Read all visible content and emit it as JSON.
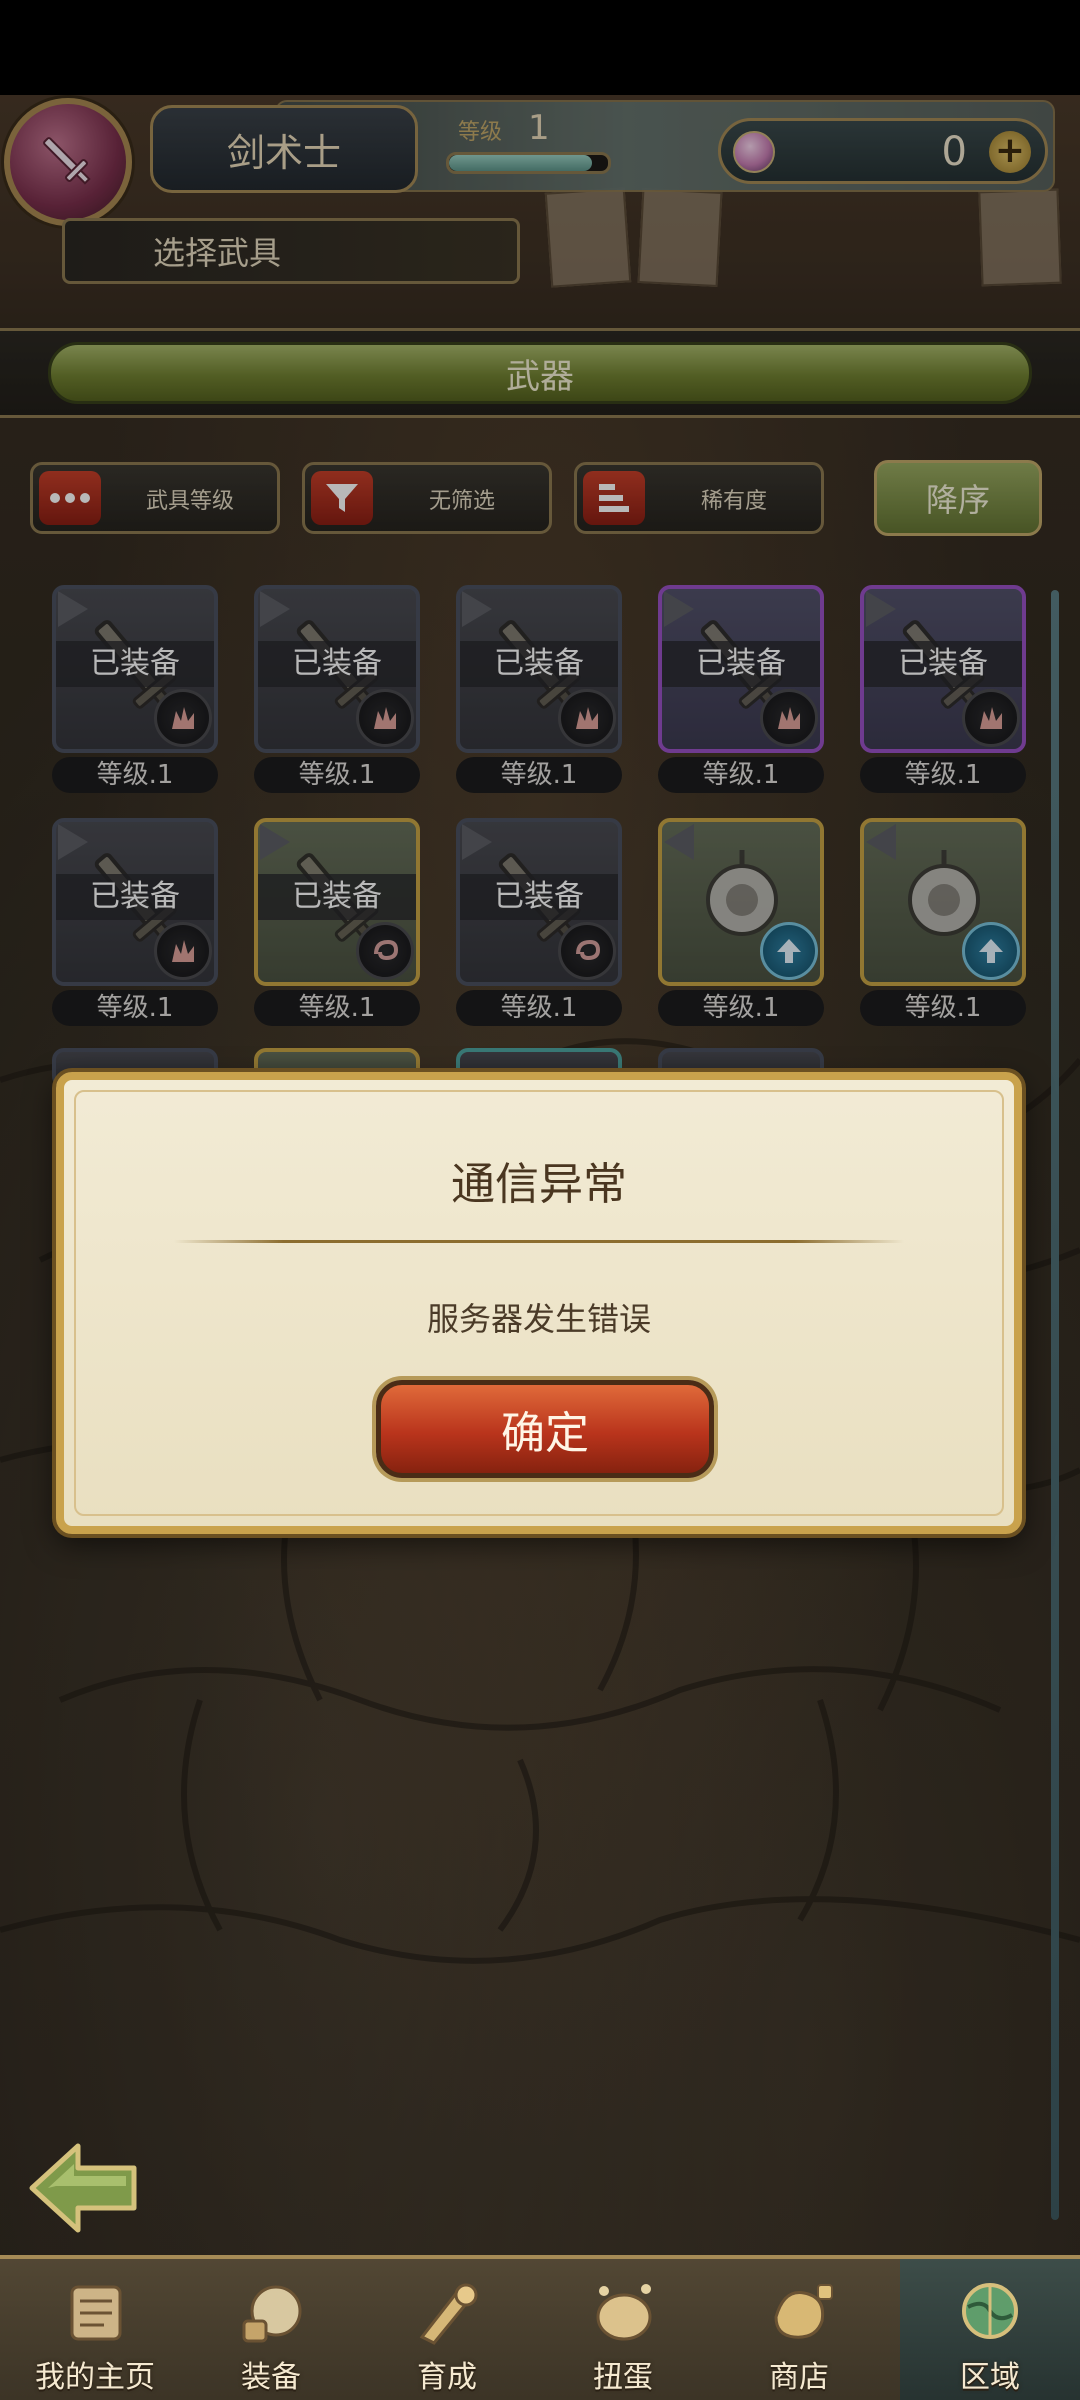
{
  "header": {
    "role_name": "剑术士",
    "level_label": "等级",
    "level_value": "1",
    "level_progress": 0.9,
    "currency_value": "0",
    "subtitle": "选择武具",
    "active_tab": "武器"
  },
  "filters": [
    {
      "label": "武具等级",
      "icon": "dots-icon"
    },
    {
      "label": "无筛选",
      "icon": "funnel-icon"
    },
    {
      "label": "稀有度",
      "icon": "bars-icon"
    }
  ],
  "sort_label": "降序",
  "weapons": [
    {
      "status": "已装备",
      "level": "等级.1",
      "frame": "normal",
      "element": "fire"
    },
    {
      "status": "已装备",
      "level": "等级.1",
      "frame": "normal",
      "element": "fire"
    },
    {
      "status": "已装备",
      "level": "等级.1",
      "frame": "normal",
      "element": "fire"
    },
    {
      "status": "已装备",
      "level": "等级.1",
      "frame": "rare",
      "element": "fire"
    },
    {
      "status": "已装备",
      "level": "等级.1",
      "frame": "rare",
      "element": "fire"
    },
    {
      "status": "已装备",
      "level": "等级.1",
      "frame": "normal",
      "element": "fire"
    },
    {
      "status": "已装备",
      "level": "等级.1",
      "frame": "gold",
      "element": "wind"
    },
    {
      "status": "已装备",
      "level": "等级.1",
      "frame": "normal",
      "element": "wind"
    },
    {
      "status": "",
      "level": "等级.1",
      "frame": "gold",
      "element": "upgrade"
    },
    {
      "status": "",
      "level": "等级.1",
      "frame": "gold",
      "element": "upgrade"
    }
  ],
  "dialog": {
    "title": "通信异常",
    "message": "服务器发生错误",
    "confirm": "确定"
  },
  "nav": [
    {
      "label": "我的主页",
      "icon": "scroll-icon"
    },
    {
      "label": "装备",
      "icon": "equipment-icon"
    },
    {
      "label": "育成",
      "icon": "training-icon"
    },
    {
      "label": "扭蛋",
      "icon": "gacha-icon"
    },
    {
      "label": "商店",
      "icon": "shop-icon"
    },
    {
      "label": "区域",
      "icon": "globe-icon"
    }
  ],
  "colors": {
    "accent_green": "#728232",
    "confirm_red": "#b9341c",
    "frame_gold": "#c9a24c"
  }
}
